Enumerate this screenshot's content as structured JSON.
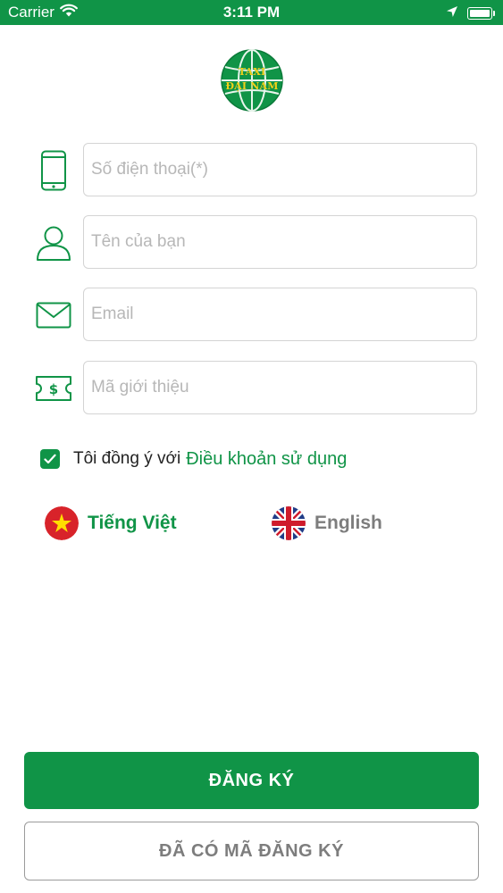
{
  "status_bar": {
    "carrier": "Carrier",
    "time": "3:11 PM",
    "icons": [
      "wifi-icon",
      "location-arrow-icon",
      "battery-icon"
    ]
  },
  "logo": {
    "line1": "TAXI",
    "line2": "ĐẠI NAM"
  },
  "form": {
    "phone": {
      "placeholder": "Số điện thoại(*)",
      "value": "",
      "icon": "phone-icon"
    },
    "name": {
      "placeholder": "Tên của bạn",
      "value": "",
      "icon": "user-icon"
    },
    "email": {
      "placeholder": "Email",
      "value": "",
      "icon": "envelope-icon"
    },
    "referral": {
      "placeholder": "Mã giới thiệu",
      "value": "",
      "icon": "ticket-dollar-icon"
    }
  },
  "agreement": {
    "checked": true,
    "text": "Tôi đồng ý với",
    "link": "Điều khoản sử dụng"
  },
  "languages": [
    {
      "label": "Tiếng Việt",
      "selected": true,
      "icon": "vietnam-flag-icon"
    },
    {
      "label": "English",
      "selected": false,
      "icon": "uk-flag-icon"
    }
  ],
  "buttons": {
    "register": "ĐĂNG KÝ",
    "have_code": "ĐÃ CÓ MÃ ĐĂNG KÝ"
  },
  "colors": {
    "brand_green": "#109447",
    "logo_yellow": "#f2d11a",
    "placeholder_gray": "#b7b7b7",
    "muted_text": "#7d7d7d"
  }
}
